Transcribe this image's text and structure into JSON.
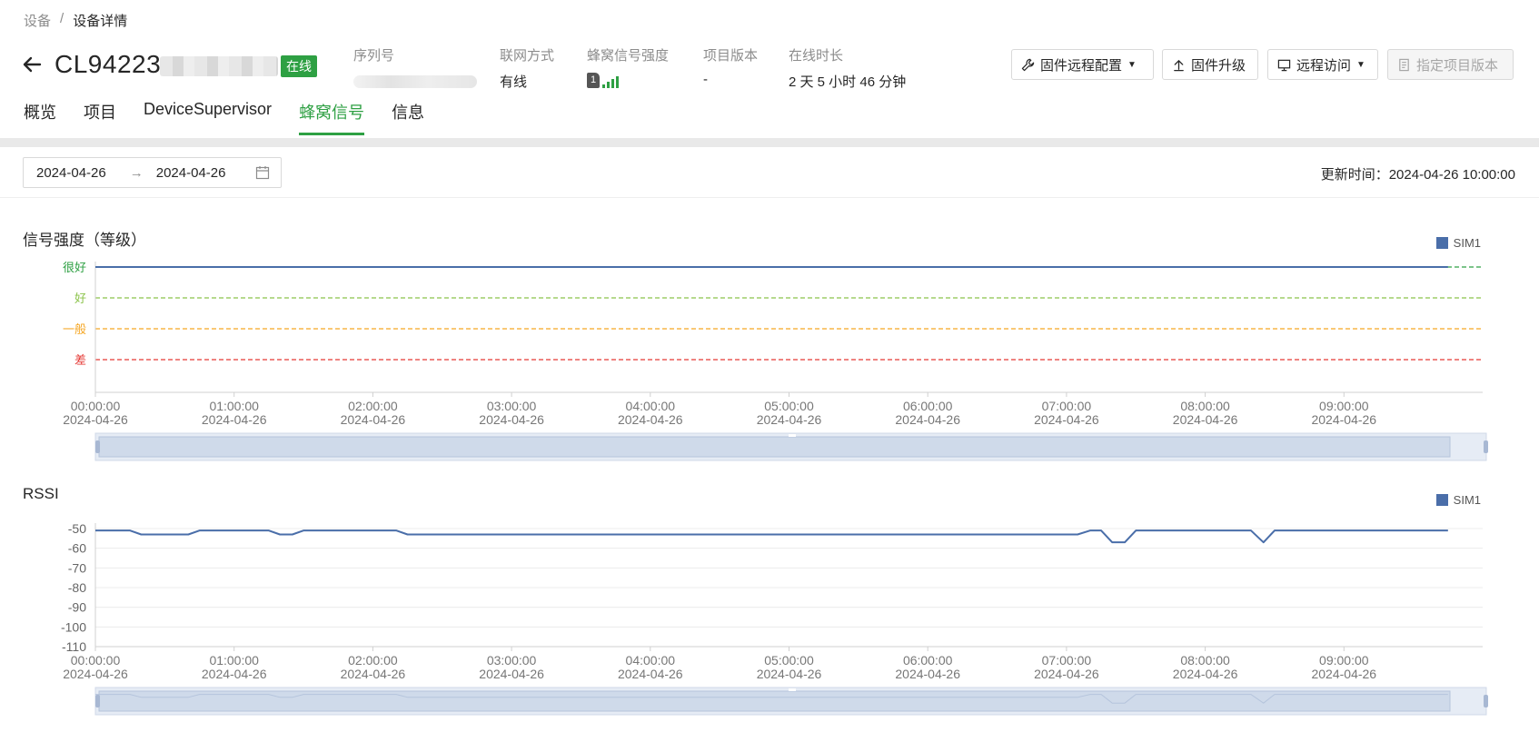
{
  "breadcrumb": {
    "root": "设备",
    "separator": "/",
    "current": "设备详情"
  },
  "device": {
    "name": "CL94223",
    "status": "在线"
  },
  "meta": {
    "serial_label": "序列号",
    "network_label": "联网方式",
    "network_value": "有线",
    "cellular_label": "蜂窝信号强度",
    "sim_number": "1",
    "project_version_label": "项目版本",
    "project_version_value": "-",
    "online_label": "在线时长",
    "online_value": "2 天 5 小时 46 分钟"
  },
  "buttons": {
    "firmware_config": "固件远程配置",
    "firmware_upgrade": "固件升级",
    "remote_access": "远程访问",
    "assign_version": "指定项目版本"
  },
  "tabs": [
    {
      "label": "概览",
      "active": false
    },
    {
      "label": "项目",
      "active": false
    },
    {
      "label": "DeviceSupervisor",
      "active": false
    },
    {
      "label": "蜂窝信号",
      "active": true
    },
    {
      "label": "信息",
      "active": false
    }
  ],
  "date_range": {
    "start": "2024-04-26",
    "end": "2024-04-26",
    "arrow": "→"
  },
  "update": {
    "label": "更新时间：",
    "value": "2024-04-26 10:00:00"
  },
  "colors": {
    "brand": "#2ea043",
    "series": "#4a6ea9",
    "very_good": "#2ea043",
    "good": "#8bc34a",
    "normal": "#f5a623",
    "poor": "#e53935"
  },
  "chart_data": [
    {
      "type": "line",
      "title": "信号强度（等级）",
      "legend": [
        "SIM1"
      ],
      "legend_position": "top-right",
      "y_levels": [
        {
          "label": "很好",
          "color": "#2ea043"
        },
        {
          "label": "好",
          "color": "#8bc34a"
        },
        {
          "label": "一般",
          "color": "#f5a623"
        },
        {
          "label": "差",
          "color": "#e53935"
        }
      ],
      "x_ticks": [
        {
          "time": "00:00:00",
          "date": "2024-04-26"
        },
        {
          "time": "01:00:00",
          "date": "2024-04-26"
        },
        {
          "time": "02:00:00",
          "date": "2024-04-26"
        },
        {
          "time": "03:00:00",
          "date": "2024-04-26"
        },
        {
          "time": "04:00:00",
          "date": "2024-04-26"
        },
        {
          "time": "05:00:00",
          "date": "2024-04-26"
        },
        {
          "time": "06:00:00",
          "date": "2024-04-26"
        },
        {
          "time": "07:00:00",
          "date": "2024-04-26"
        },
        {
          "time": "08:00:00",
          "date": "2024-04-26"
        },
        {
          "time": "09:00:00",
          "date": "2024-04-26"
        }
      ],
      "xlim_hours": [
        0,
        10
      ],
      "series": [
        {
          "name": "SIM1",
          "x_hours": [
            0,
            9.75
          ],
          "level": [
            "很好",
            "很好"
          ]
        }
      ]
    },
    {
      "type": "line",
      "title": "RSSI",
      "legend": [
        "SIM1"
      ],
      "legend_position": "top-right",
      "y_ticks": [
        -50,
        -60,
        -70,
        -80,
        -90,
        -100,
        -110
      ],
      "ylim": [
        -110,
        -50
      ],
      "grid": true,
      "x_ticks": [
        {
          "time": "00:00:00",
          "date": "2024-04-26"
        },
        {
          "time": "01:00:00",
          "date": "2024-04-26"
        },
        {
          "time": "02:00:00",
          "date": "2024-04-26"
        },
        {
          "time": "03:00:00",
          "date": "2024-04-26"
        },
        {
          "time": "04:00:00",
          "date": "2024-04-26"
        },
        {
          "time": "05:00:00",
          "date": "2024-04-26"
        },
        {
          "time": "06:00:00",
          "date": "2024-04-26"
        },
        {
          "time": "07:00:00",
          "date": "2024-04-26"
        },
        {
          "time": "08:00:00",
          "date": "2024-04-26"
        },
        {
          "time": "09:00:00",
          "date": "2024-04-26"
        }
      ],
      "xlim_hours": [
        0,
        10
      ],
      "series": [
        {
          "name": "SIM1",
          "x_hours": [
            0,
            0.25,
            0.33,
            0.67,
            0.75,
            1.25,
            1.33,
            1.42,
            1.5,
            2.17,
            2.25,
            7.08,
            7.17,
            7.25,
            7.33,
            7.42,
            7.5,
            8.33,
            8.42,
            8.5,
            9.75
          ],
          "y": [
            -51,
            -51,
            -53,
            -53,
            -51,
            -51,
            -53,
            -53,
            -51,
            -51,
            -53,
            -53,
            -51,
            -51,
            -57,
            -57,
            -51,
            -51,
            -57,
            -51,
            -51
          ]
        }
      ]
    }
  ]
}
